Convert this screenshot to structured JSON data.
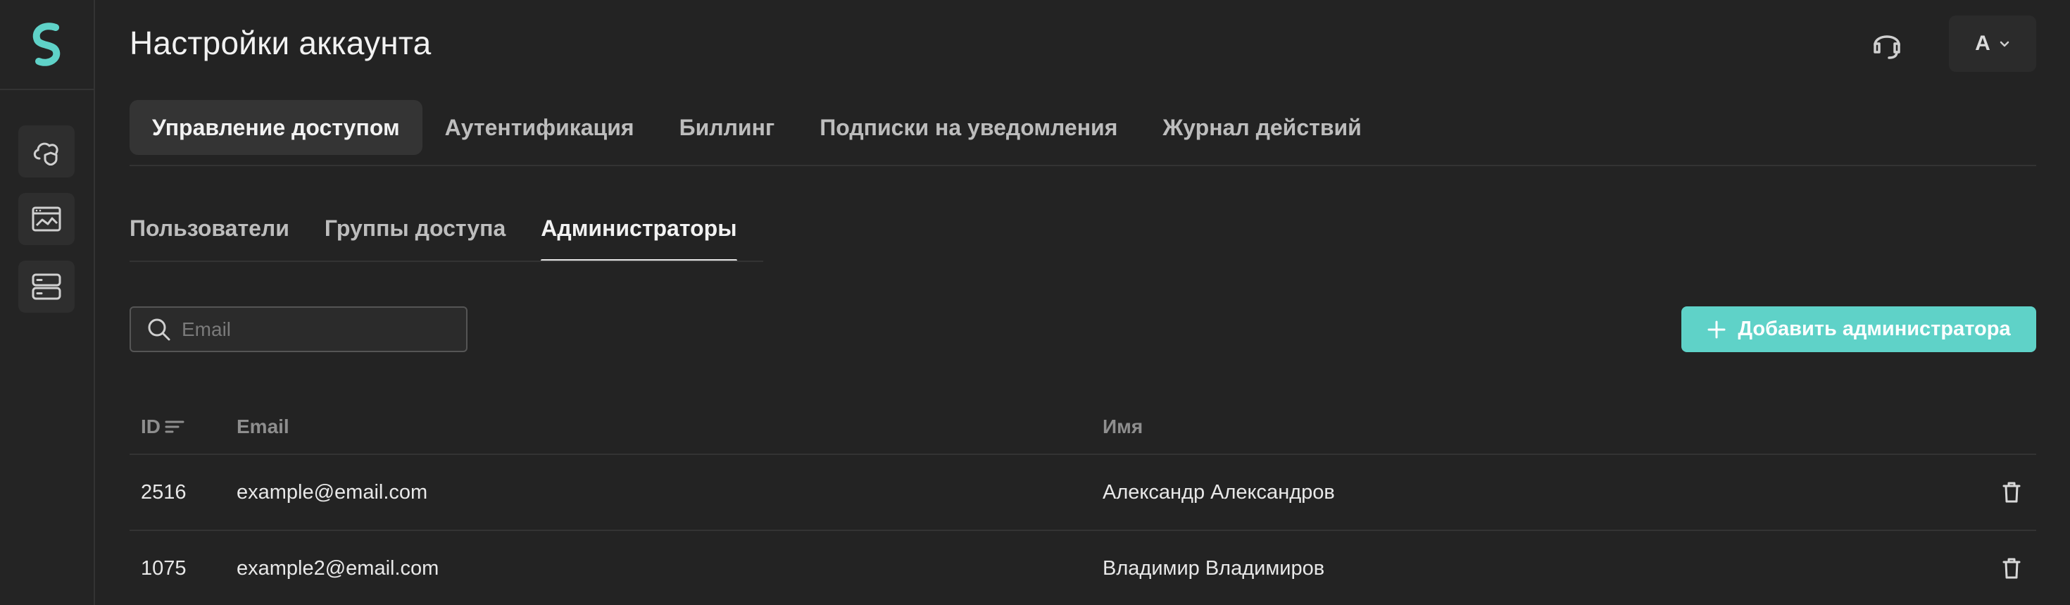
{
  "header": {
    "title": "Настройки аккаунта",
    "account_initial": "A"
  },
  "sidebar": {
    "items": [
      {
        "icon": "cloud-shield-icon"
      },
      {
        "icon": "dashboard-image-icon"
      },
      {
        "icon": "server-icon"
      }
    ]
  },
  "tabs": [
    {
      "label": "Управление доступом",
      "active": true
    },
    {
      "label": "Аутентификация",
      "active": false
    },
    {
      "label": "Биллинг",
      "active": false
    },
    {
      "label": "Подписки на уведомления",
      "active": false
    },
    {
      "label": "Журнал действий",
      "active": false
    }
  ],
  "subtabs": [
    {
      "label": "Пользователи",
      "active": false
    },
    {
      "label": "Группы доступа",
      "active": false
    },
    {
      "label": "Администраторы",
      "active": true
    }
  ],
  "search": {
    "placeholder": "Email",
    "value": ""
  },
  "add_button": {
    "label": "Добавить администратора"
  },
  "table": {
    "columns": {
      "id": "ID",
      "email": "Email",
      "name": "Имя"
    },
    "rows": [
      {
        "id": "2516",
        "email": "example@email.com",
        "name": "Александр Александров"
      },
      {
        "id": "1075",
        "email": "example2@email.com",
        "name": "Владимир Владимиров"
      }
    ]
  },
  "colors": {
    "accent": "#5fd2c8",
    "background": "#232323"
  }
}
